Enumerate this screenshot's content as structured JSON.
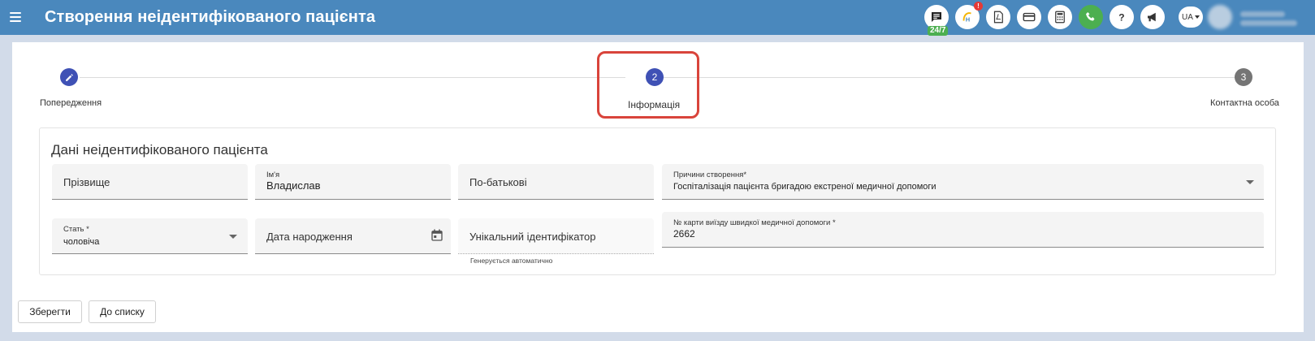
{
  "header": {
    "title": "Створення неідентифікованого пацієнта",
    "support_badge": "24/7",
    "notification_count": "!",
    "language": "UA",
    "icons": [
      "chat-icon",
      "hospital-logo-icon",
      "pdf-icon",
      "card-icon",
      "calculator-icon",
      "phone-icon",
      "help-icon",
      "megaphone-icon"
    ]
  },
  "stepper": {
    "steps": [
      {
        "number": "",
        "label": "Попередження",
        "state": "completed",
        "icon": "pencil-icon"
      },
      {
        "number": "2",
        "label": "Інформація",
        "state": "active"
      },
      {
        "number": "3",
        "label": "Контактна особа",
        "state": "idle"
      }
    ]
  },
  "form": {
    "title": "Дані неідентифікованого пацієнта",
    "surname": {
      "placeholder": "Прізвище",
      "value": ""
    },
    "first_name": {
      "label": "Ім'я",
      "value": "Владислав"
    },
    "patronymic": {
      "placeholder": "По-батькові",
      "value": ""
    },
    "reason": {
      "label": "Причини створення*",
      "value": "Госпіталізація пацієнта бригадою екстреної медичної допомоги"
    },
    "sex": {
      "label": "Стать *",
      "value": "чоловіча"
    },
    "birth_date": {
      "placeholder": "Дата народження",
      "value": ""
    },
    "unique_id": {
      "placeholder": "Унікальний ідентифікатор",
      "hint": "Генерується автоматично"
    },
    "ambulance_card": {
      "label": "№ карти виїзду швидкої медичної допомоги *",
      "value": "2662"
    }
  },
  "actions": {
    "save_label": "Зберегти",
    "to_list_label": "До списку"
  },
  "colors": {
    "header": "#4a88bd",
    "step_active": "#3f51b5",
    "step_idle": "#757575",
    "highlight": "#d9443b"
  }
}
